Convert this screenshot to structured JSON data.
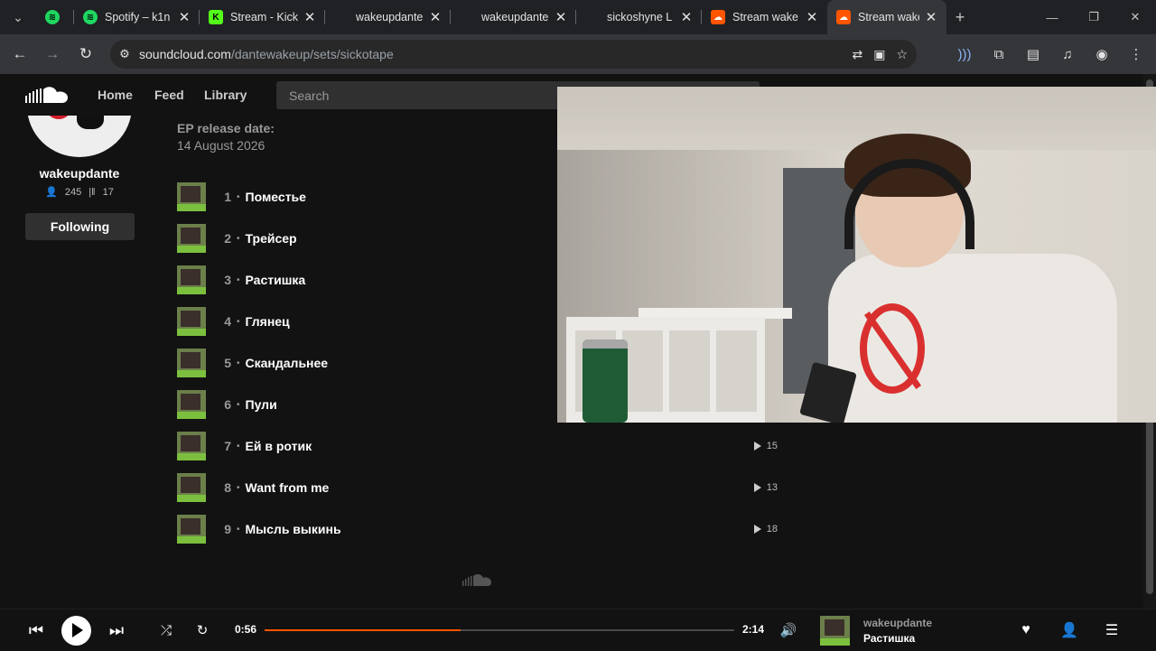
{
  "browser": {
    "tabs": [
      {
        "title": "",
        "favicon": "spotify-icon",
        "active": false
      },
      {
        "title": "Spotify – k1n",
        "favicon": "spotify-icon",
        "active": false
      },
      {
        "title": "Stream - Kick",
        "favicon": "kick-icon",
        "active": false
      },
      {
        "title": "wakeupdante",
        "favicon": "",
        "active": false
      },
      {
        "title": "wakeupdante",
        "favicon": "",
        "active": false
      },
      {
        "title": "sickoshyne L",
        "favicon": "",
        "active": false
      },
      {
        "title": "Stream wake",
        "favicon": "soundcloud-icon",
        "active": false
      },
      {
        "title": "Stream wake",
        "favicon": "soundcloud-icon",
        "active": true
      }
    ],
    "url_host": "soundcloud.com",
    "url_path": "/dantewakeup/sets/sickotape"
  },
  "soundcloud": {
    "nav": {
      "home": "Home",
      "feed": "Feed",
      "library": "Library"
    },
    "search_placeholder": "Search",
    "profile": {
      "username": "wakeupdante",
      "followers": "245",
      "tracks": "17",
      "follow_button": "Following"
    },
    "release": {
      "label": "EP release date:",
      "date": "14 August 2026"
    },
    "tracks": [
      {
        "num": "1",
        "title": "Поместье",
        "plays": ""
      },
      {
        "num": "2",
        "title": "Трейсер",
        "plays": ""
      },
      {
        "num": "3",
        "title": "Растишка",
        "plays": ""
      },
      {
        "num": "4",
        "title": "Глянец",
        "plays": ""
      },
      {
        "num": "5",
        "title": "Скандальнее",
        "plays": ""
      },
      {
        "num": "6",
        "title": "Пули",
        "plays": ""
      },
      {
        "num": "7",
        "title": "Ей в ротик",
        "plays": "15"
      },
      {
        "num": "8",
        "title": "Want from me",
        "plays": "13"
      },
      {
        "num": "9",
        "title": "Мысль выкинь",
        "plays": "18"
      }
    ]
  },
  "player": {
    "elapsed": "0:56",
    "duration": "2:14",
    "progress_fraction": 0.418,
    "artist": "wakeupdante",
    "title": "Растишка"
  },
  "colors": {
    "accent": "#ff5500",
    "background": "#121212"
  }
}
